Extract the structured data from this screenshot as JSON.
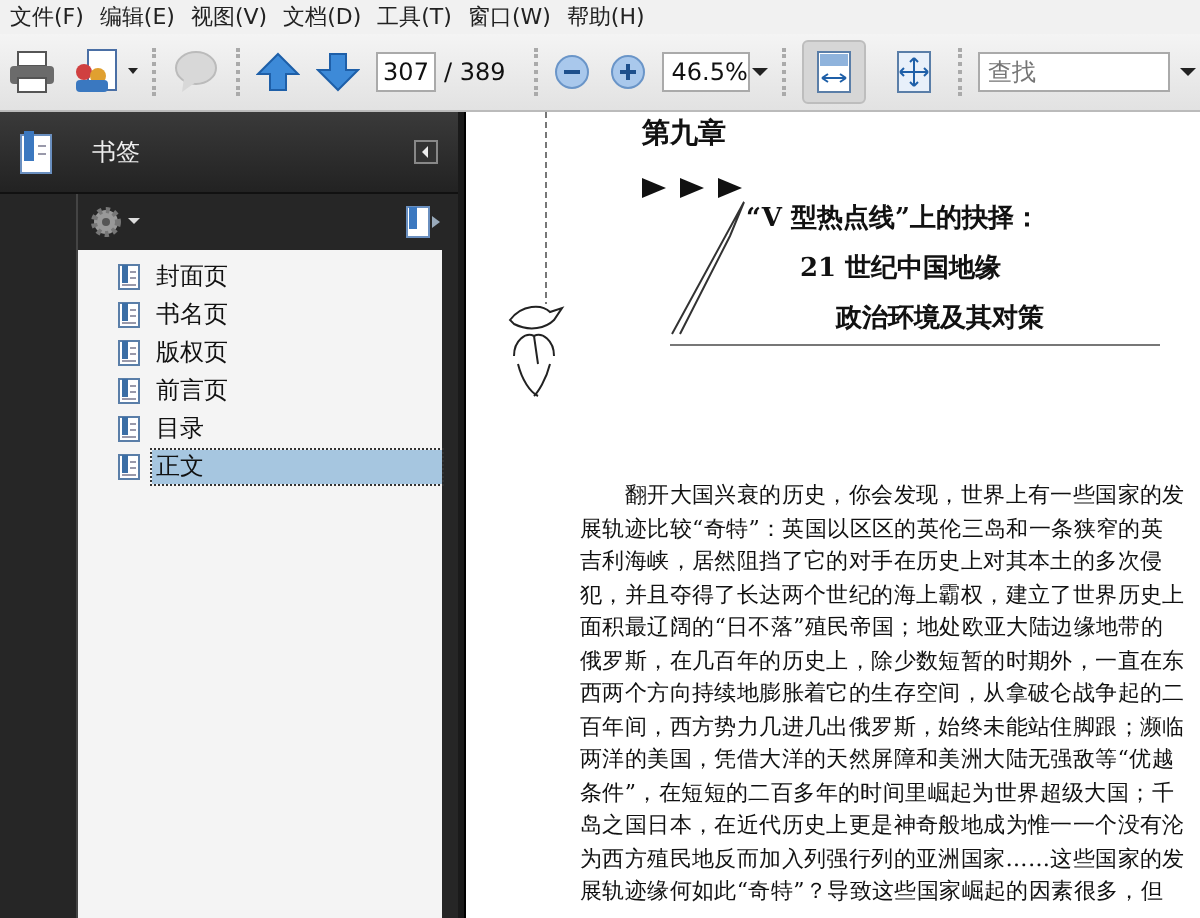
{
  "menu": [
    {
      "label": "文件(F)"
    },
    {
      "label": "编辑(E)"
    },
    {
      "label": "视图(V)"
    },
    {
      "label": "文档(D)"
    },
    {
      "label": "工具(T)"
    },
    {
      "label": "窗口(W)"
    },
    {
      "label": "帮助(H)"
    }
  ],
  "toolbar": {
    "page_number": "307",
    "page_count": "/ 389",
    "zoom": "46.5%",
    "search": {
      "placeholder": "查找"
    },
    "view_buttons": [
      {
        "kind": "fit-width",
        "selected": true
      },
      {
        "kind": "full-page",
        "selected": false
      }
    ]
  },
  "bookmarks": {
    "title": "书签",
    "items": [
      {
        "label": "封面页",
        "selected": false
      },
      {
        "label": "书名页",
        "selected": false
      },
      {
        "label": "版权页",
        "selected": false
      },
      {
        "label": "前言页",
        "selected": false
      },
      {
        "label": "目录",
        "selected": false
      },
      {
        "label": "正文",
        "selected": true
      }
    ]
  },
  "document": {
    "chapter": "第九章",
    "title_lines": [
      "“V 型热点线”上的抉择：",
      "21 世纪中国地缘",
      "政治环境及其对策"
    ],
    "paragraph_lines": [
      "翻开大国兴衰的历史，你会发现，世界上有一些国家的发",
      "展轨迹比较“奇特”：英国以区区的英伦三岛和一条狭窄的英",
      "吉利海峡，居然阻挡了它的对手在历史上对其本土的多次侵",
      "犯，并且夺得了长达两个世纪的海上霸权，建立了世界历史上",
      "面积最辽阔的“日不落”殖民帝国；地处欧亚大陆边缘地带的",
      "俄罗斯，在几百年的历史上，除少数短暂的时期外，一直在东",
      "西两个方向持续地膨胀着它的生存空间，从拿破仑战争起的二",
      "百年间，西方势力几进几出俄罗斯，始终未能站住脚跟；濒临",
      "两洋的美国，凭借大洋的天然屏障和美洲大陆无强敌等“优越",
      "条件”，在短短的二百多年的时间里崛起为世界超级大国；千",
      "岛之国日本，在近代历史上更是神奇般地成为惟一一个没有沦",
      "为西方殖民地反而加入列强行列的亚洲国家……这些国家的发",
      "展轨迹缘何如此“奇特”？导致这些国家崛起的因素很多，但"
    ]
  }
}
